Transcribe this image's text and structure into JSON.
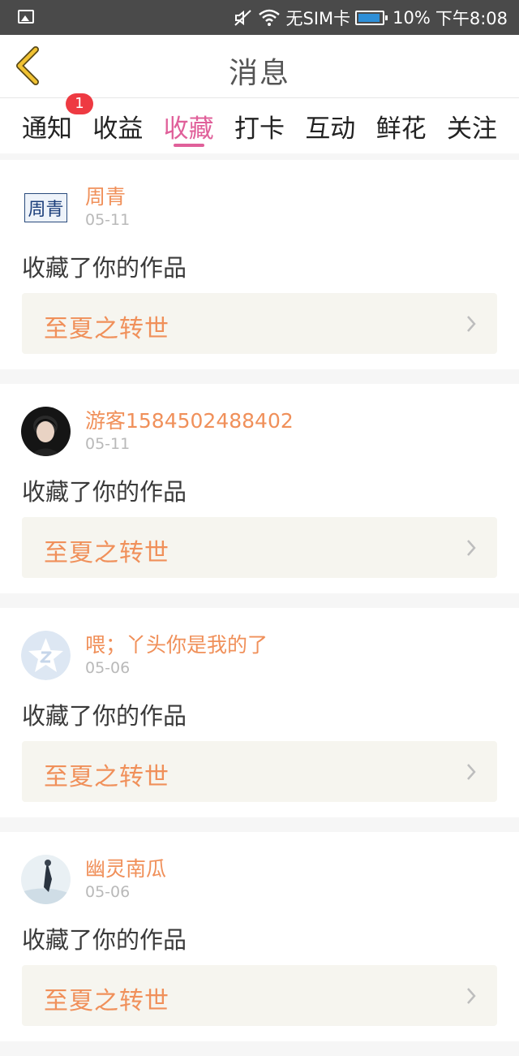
{
  "status_bar": {
    "carrier": "无SIM卡",
    "battery": "10%",
    "time": "下午8:08"
  },
  "header": {
    "title": "消息"
  },
  "tabs": [
    {
      "label": "通知",
      "badge": "1"
    },
    {
      "label": "收益"
    },
    {
      "label": "收藏",
      "active": true
    },
    {
      "label": "打卡"
    },
    {
      "label": "互动"
    },
    {
      "label": "鲜花"
    },
    {
      "label": "关注"
    }
  ],
  "messages": [
    {
      "user": "周青",
      "date": "05-11",
      "action": "收藏了你的作品",
      "work": "至夏之转世",
      "avatar_text": "周青"
    },
    {
      "user": "游客1584502488402",
      "date": "05-11",
      "action": "收藏了你的作品",
      "work": "至夏之转世"
    },
    {
      "user": "喂；丫头你是我的了",
      "date": "05-06",
      "action": "收藏了你的作品",
      "work": "至夏之转世"
    },
    {
      "user": "幽灵南瓜",
      "date": "05-06",
      "action": "收藏了你的作品",
      "work": "至夏之转世"
    }
  ],
  "colors": {
    "accent": "#e0609a",
    "name": "#f0905a",
    "badge": "#ee3a42"
  }
}
